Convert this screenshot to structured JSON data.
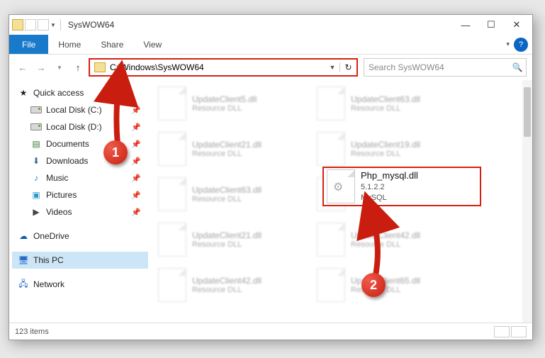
{
  "title": "SysWOW64",
  "ribbon": {
    "file": "File",
    "home": "Home",
    "share": "Share",
    "view": "View"
  },
  "address": {
    "path": "C:\\Windows\\SysWOW64",
    "search_placeholder": "Search SysWOW64"
  },
  "sidebar": {
    "quick_access": "Quick access",
    "local_c": "Local Disk (C:)",
    "local_d": "Local Disk (D:)",
    "documents": "Documents",
    "downloads": "Downloads",
    "music": "Music",
    "pictures": "Pictures",
    "videos": "Videos",
    "onedrive": "OneDrive",
    "this_pc": "This PC",
    "network": "Network"
  },
  "highlight": {
    "name": "Php_mysql.dll",
    "version": "5.1.2.2",
    "desc": "MySQL"
  },
  "bg_files": [
    {
      "name": "UpdateClient5.dll",
      "desc": "Resource DLL"
    },
    {
      "name": "UpdateClient63.dll",
      "desc": "Resource DLL"
    },
    {
      "name": "UpdateClient21.dll",
      "desc": "Resource DLL"
    },
    {
      "name": "UpdateClient19.dll",
      "desc": "Resource DLL"
    },
    {
      "name": "UpdateClient63.dll",
      "desc": "Resource DLL"
    },
    {
      "name": "",
      "desc": ""
    },
    {
      "name": "UpdateClient21.dll",
      "desc": "Resource DLL"
    },
    {
      "name": "UpdateClient42.dll",
      "desc": "Resource DLL"
    },
    {
      "name": "UpdateClient42.dll",
      "desc": "Resource DLL"
    },
    {
      "name": "UpdateClient65.dll",
      "desc": "Resource DLL"
    }
  ],
  "status": {
    "count": "123 items"
  },
  "callouts": {
    "one": "1",
    "two": "2"
  }
}
